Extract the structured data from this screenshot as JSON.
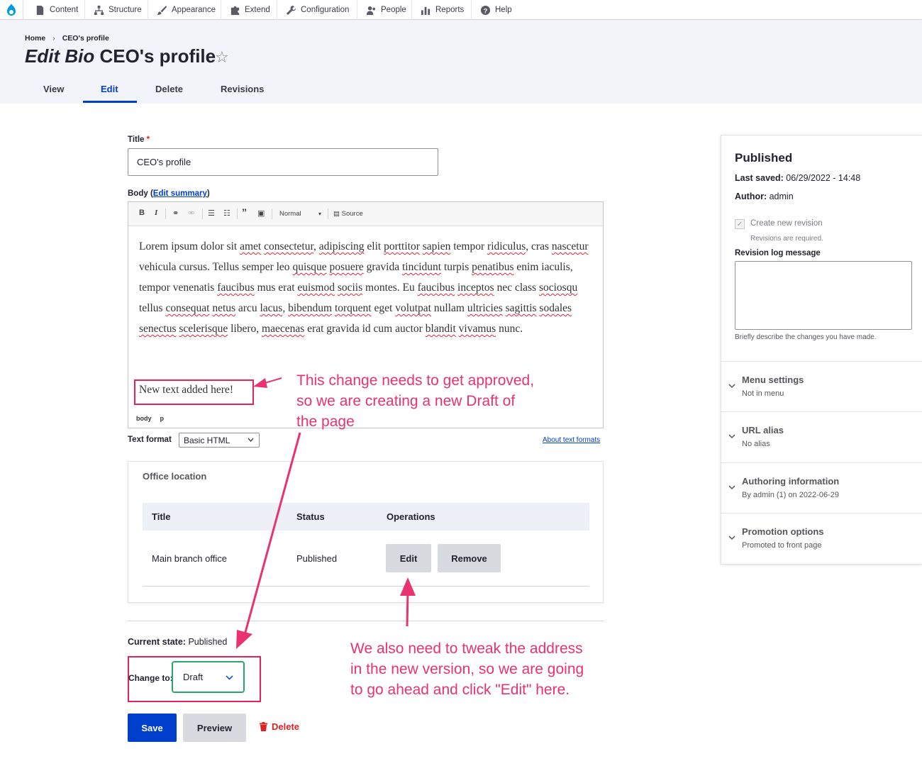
{
  "toolbar": {
    "items": [
      "Content",
      "Structure",
      "Appearance",
      "Extend",
      "Configuration",
      "People",
      "Reports",
      "Help"
    ]
  },
  "breadcrumb": [
    "Home",
    "CEO's profile"
  ],
  "page": {
    "title_prefix": "Edit Bio",
    "title_rest": "CEO's profile"
  },
  "tabs": [
    "View",
    "Edit",
    "Delete",
    "Revisions"
  ],
  "form": {
    "title_label": "Title",
    "title_required": "*",
    "title_value": "CEO's profile",
    "body_label": "Body (",
    "body_link": "Edit summary",
    "body_label_end": ")",
    "editor_style": "Normal",
    "editor_source": "Source",
    "body_paragraph": "Lorem ipsum dolor sit amet consectetur, adipiscing elit porttitor sapien tempor ridiculus, cras nascetur vehicula cursus. Tellus semper leo quisque posuere gravida tincidunt turpis penatibus enim iaculis, tempor venenatis faucibus mus erat euismod sociis montes. Eu faucibus inceptos nec class sociosqu tellus consequat netus arcu lacus, bibendum torquent eget volutpat nullam ultricies sagittis sodales senectus scelerisque libero, maecenas erat gravida id cum auctor blandit vivamus nunc.",
    "new_text": "New text added here!",
    "path": [
      "body",
      "p"
    ],
    "text_format_label": "Text format",
    "text_format_value": "Basic HTML",
    "about_formats": "About text formats"
  },
  "office": {
    "title": "Office location",
    "headers": [
      "Title",
      "Status",
      "Operations"
    ],
    "row": {
      "title": "Main branch office",
      "status": "Published"
    },
    "edit_label": "Edit",
    "remove_label": "Remove"
  },
  "moderation": {
    "current_label": "Current state:",
    "current_value": "Published",
    "change_label": "Change to:",
    "change_value": "Draft"
  },
  "actions": {
    "save": "Save",
    "preview": "Preview",
    "delete": "Delete"
  },
  "annotations": {
    "top": [
      "This change needs to get approved,",
      "so we are creating a new Draft of",
      "the page"
    ],
    "bottom": [
      "We also need to tweak the address",
      "in the new version, so we are going",
      "to go ahead and click \"Edit\" here."
    ],
    "color": "#e8336e"
  },
  "sidebar": {
    "status": "Published",
    "last_saved_label": "Last saved:",
    "last_saved_value": "06/29/2022 - 14:48",
    "author_label": "Author:",
    "author_value": "admin",
    "revision_checkbox": "Create new revision",
    "revision_note": "Revisions are required.",
    "log_label": "Revision log message",
    "log_help": "Briefly describe the changes you have made.",
    "sections": [
      {
        "title": "Menu settings",
        "sub": "Not in menu"
      },
      {
        "title": "URL alias",
        "sub": "No alias"
      },
      {
        "title": "Authoring information",
        "sub": "By admin (1) on 2022-06-29"
      },
      {
        "title": "Promotion options",
        "sub": "Promoted to front page"
      }
    ]
  },
  "colors": {
    "primary": "#003ecc",
    "danger": "#dc2323",
    "success": "#26a769",
    "annotation": "#e8336e"
  }
}
